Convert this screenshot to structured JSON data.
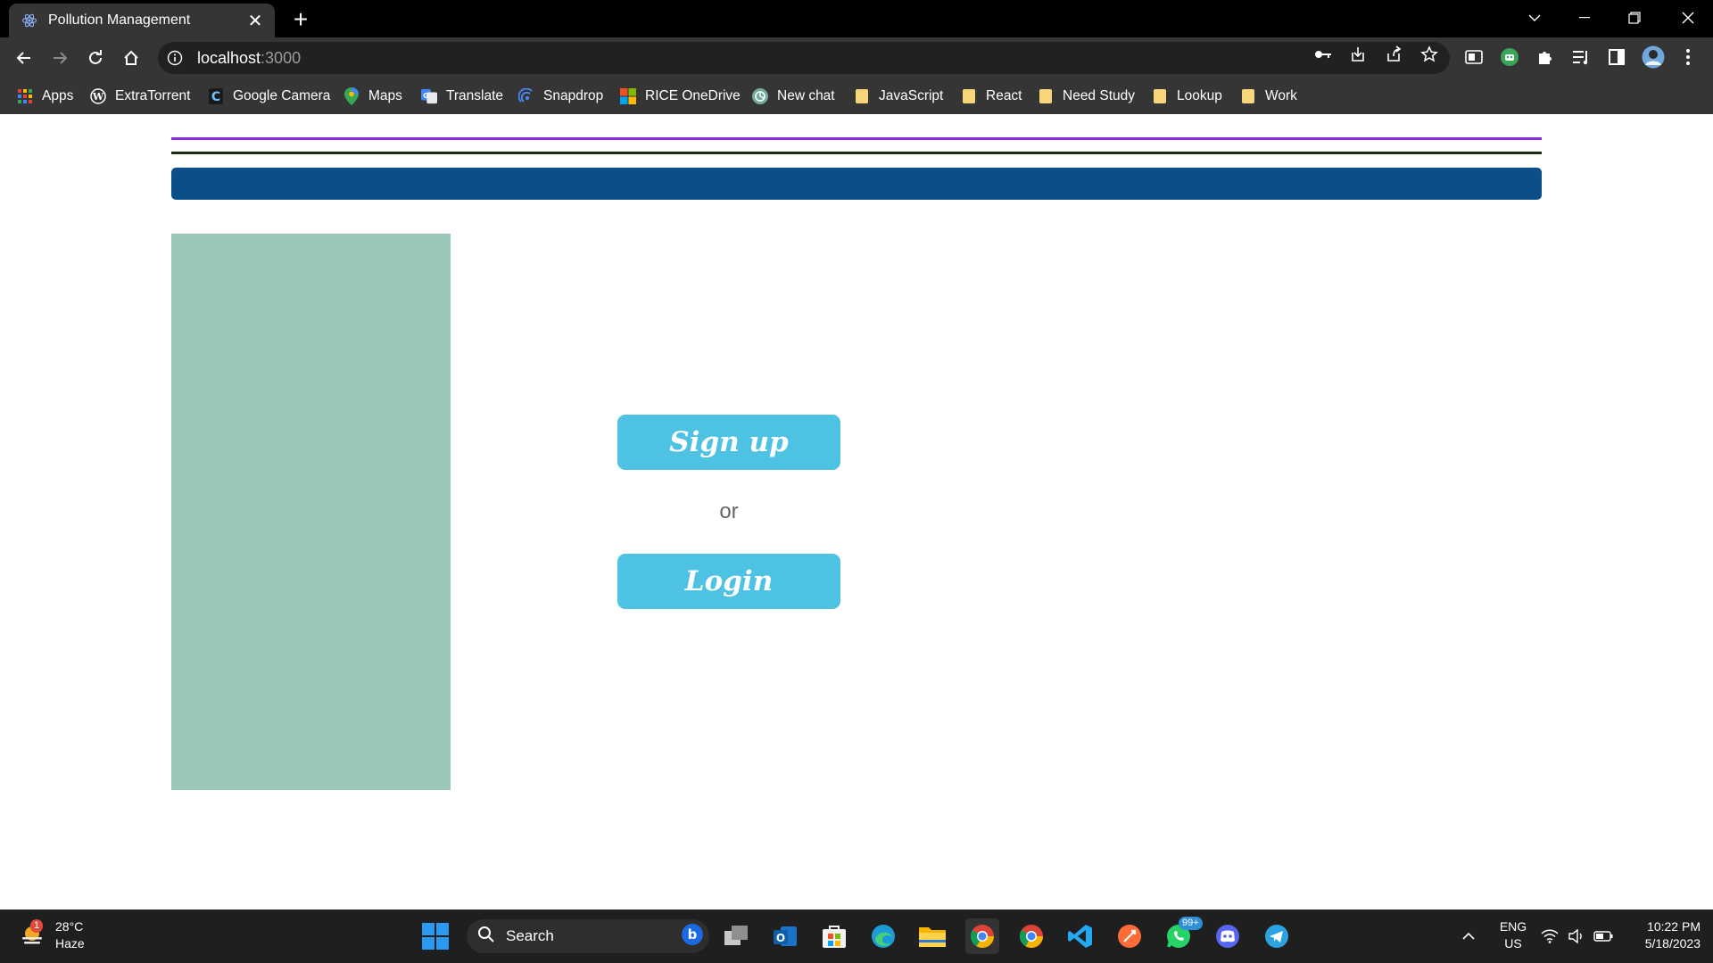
{
  "browser": {
    "tab_title": "Pollution Management",
    "url_host": "localhost",
    "url_port": ":3000",
    "bookmarks": [
      {
        "label": "Apps",
        "icon": "apps-grid-icon"
      },
      {
        "label": "ExtraTorrent",
        "icon": "wordpress-icon"
      },
      {
        "label": "Google Camera",
        "icon": "c-logo-icon"
      },
      {
        "label": "Maps",
        "icon": "maps-pin-icon"
      },
      {
        "label": "Translate",
        "icon": "translate-icon"
      },
      {
        "label": "Snapdrop",
        "icon": "snapdrop-icon"
      },
      {
        "label": "RICE OneDrive",
        "icon": "microsoft-logo-icon"
      },
      {
        "label": "New chat",
        "icon": "chatgpt-icon"
      },
      {
        "label": "JavaScript",
        "icon": "folder-icon"
      },
      {
        "label": "React",
        "icon": "folder-icon"
      },
      {
        "label": "Need Study",
        "icon": "folder-icon"
      },
      {
        "label": "Lookup",
        "icon": "folder-icon"
      },
      {
        "label": "Work",
        "icon": "folder-icon"
      }
    ]
  },
  "page": {
    "signup_label": "Sign up",
    "or_label": "or",
    "login_label": "Login"
  },
  "colors": {
    "purple_line": "#8a2be2",
    "dark_line": "#1f2a14",
    "header_bar": "#0b4f8a",
    "side_panel": "#9bc7b6",
    "button": "#4ec2e2"
  },
  "taskbar": {
    "weather_badge": "1",
    "temperature": "28°C",
    "condition": "Haze",
    "search_label": "Search",
    "whatsapp_badge": "99+",
    "lang_top": "ENG",
    "lang_bottom": "US",
    "time": "10:22 PM",
    "date": "5/18/2023"
  }
}
